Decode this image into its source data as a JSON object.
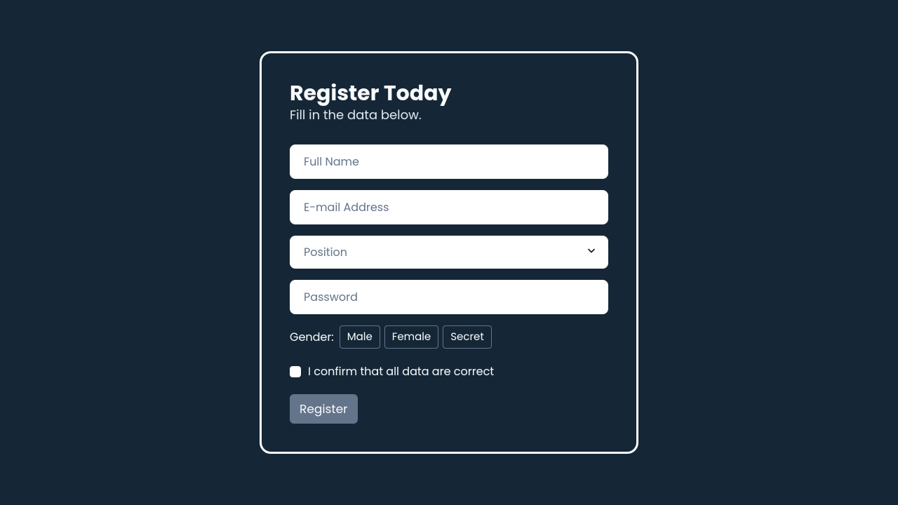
{
  "card": {
    "title": "Register Today",
    "subtitle": "Fill in the data below."
  },
  "fields": {
    "full_name_placeholder": "Full Name",
    "email_placeholder": "E-mail Address",
    "position_placeholder": "Position",
    "password_placeholder": "Password"
  },
  "gender": {
    "label": "Gender:",
    "options": {
      "male": "Male",
      "female": "Female",
      "secret": "Secret"
    }
  },
  "confirm": {
    "label": "I confirm that all data are correct"
  },
  "actions": {
    "submit": "Register"
  }
}
